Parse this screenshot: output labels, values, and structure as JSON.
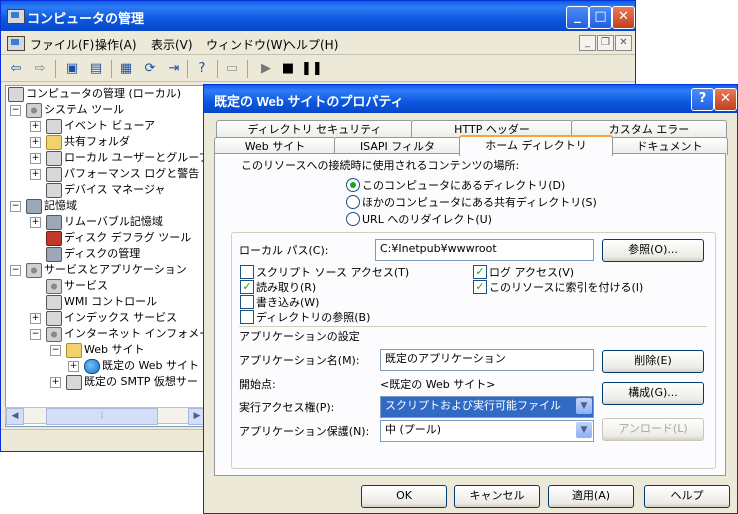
{
  "mmc": {
    "title": "コンピュータの管理",
    "menu": [
      "ファイル(F)",
      "操作(A)",
      "表示(V)",
      "ウィンドウ(W)",
      "ヘルプ(H)"
    ],
    "tree": [
      {
        "label": "コンピュータの管理 (ローカル)",
        "exp": ""
      },
      {
        "label": "システム ツール",
        "exp": "−"
      },
      {
        "label": "イベント ビューア",
        "exp": "+"
      },
      {
        "label": "共有フォルダ",
        "exp": "+"
      },
      {
        "label": "ローカル ユーザーとグループ",
        "exp": "+"
      },
      {
        "label": "パフォーマンス ログと警告",
        "exp": "+"
      },
      {
        "label": "デバイス マネージャ",
        "exp": ""
      },
      {
        "label": "記憶域",
        "exp": "−"
      },
      {
        "label": "リムーバブル記憶域",
        "exp": "+"
      },
      {
        "label": "ディスク デフラグ ツール",
        "exp": ""
      },
      {
        "label": "ディスクの管理",
        "exp": ""
      },
      {
        "label": "サービスとアプリケーション",
        "exp": "−"
      },
      {
        "label": "サービス",
        "exp": ""
      },
      {
        "label": "WMI コントロール",
        "exp": ""
      },
      {
        "label": "インデックス サービス",
        "exp": "+"
      },
      {
        "label": "インターネット インフォメーション",
        "exp": "−"
      },
      {
        "label": "Web サイト",
        "exp": "−"
      },
      {
        "label": "既定の Web サイト",
        "exp": "+"
      },
      {
        "label": "既定の SMTP 仮想サー",
        "exp": "+"
      }
    ]
  },
  "dialog": {
    "title": "既定の Web サイトのプロパティ",
    "tabs_row1": [
      "ディレクトリ セキュリティ",
      "HTTP ヘッダー",
      "カスタム エラー"
    ],
    "tabs_row2": [
      "Web サイト",
      "ISAPI フィルタ",
      "ホーム ディレクトリ",
      "ドキュメント"
    ],
    "content_source_label": "このリソースへの接続時に使用されるコンテンツの場所:",
    "radios": [
      "このコンピュータにあるディレクトリ(D)",
      "ほかのコンピュータにある共有ディレクトリ(S)",
      "URL へのリダイレクト(U)"
    ],
    "local_path_label": "ローカル パス(C):",
    "local_path_value": "C:¥Inetpub¥wwwroot",
    "browse_button": "参照(O)...",
    "checks_left": [
      {
        "label": "スクリプト ソース アクセス(T)",
        "checked": false
      },
      {
        "label": "読み取り(R)",
        "checked": true
      },
      {
        "label": "書き込み(W)",
        "checked": false
      },
      {
        "label": "ディレクトリの参照(B)",
        "checked": false
      }
    ],
    "checks_right": [
      {
        "label": "ログ アクセス(V)",
        "checked": true
      },
      {
        "label": "このリソースに索引を付ける(I)",
        "checked": true
      }
    ],
    "app_settings_heading": "アプリケーションの設定",
    "app_name_label": "アプリケーション名(M):",
    "app_name_value": "既定のアプリケーション",
    "remove_button": "削除(E)",
    "start_point_label": "開始点:",
    "start_point_value": "<既定の Web サイト>",
    "config_button": "構成(G)...",
    "exec_perm_label": "実行アクセス権(P):",
    "exec_perm_value": "スクリプトおよび実行可能ファイル",
    "app_protect_label": "アプリケーション保護(N):",
    "app_protect_value": "中 (プール)",
    "unload_button": "アンロード(L)",
    "ok_button": "OK",
    "cancel_button": "キャンセル",
    "apply_button": "適用(A)",
    "help_button": "ヘルプ"
  },
  "colors": {
    "titlebar": "#0b58e0",
    "selection": "#316ac5",
    "check": "#21a121"
  }
}
